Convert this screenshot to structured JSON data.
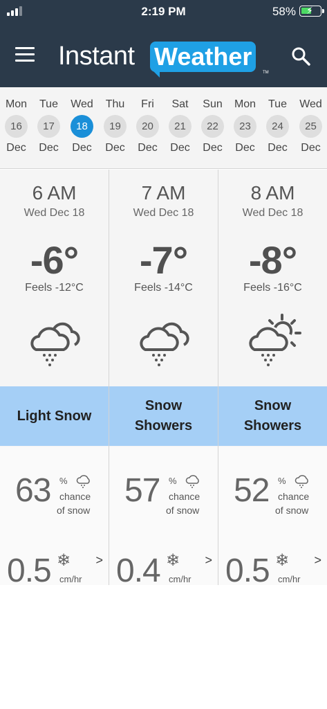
{
  "status": {
    "time": "2:19 PM",
    "battery": "58%"
  },
  "brand": {
    "part1": "Instant",
    "part2": "Weather",
    "tm": "TM"
  },
  "colors": {
    "header": "#2b3a4a",
    "accent": "#1a8fd8",
    "condition_band": "#a5cff6"
  },
  "days": [
    {
      "name": "Mon",
      "num": "16",
      "month": "Dec",
      "selected": false
    },
    {
      "name": "Tue",
      "num": "17",
      "month": "Dec",
      "selected": false
    },
    {
      "name": "Wed",
      "num": "18",
      "month": "Dec",
      "selected": true
    },
    {
      "name": "Thu",
      "num": "19",
      "month": "Dec",
      "selected": false
    },
    {
      "name": "Fri",
      "num": "20",
      "month": "Dec",
      "selected": false
    },
    {
      "name": "Sat",
      "num": "21",
      "month": "Dec",
      "selected": false
    },
    {
      "name": "Sun",
      "num": "22",
      "month": "Dec",
      "selected": false
    },
    {
      "name": "Mon",
      "num": "23",
      "month": "Dec",
      "selected": false
    },
    {
      "name": "Tue",
      "num": "24",
      "month": "Dec",
      "selected": false
    },
    {
      "name": "Wed",
      "num": "25",
      "month": "Dec",
      "selected": false
    }
  ],
  "hours": [
    {
      "hour": "6 AM",
      "date": "Wed Dec 18",
      "temp": "-6°",
      "feels": "Feels -12°C",
      "icon": "cloud-snow-icon",
      "condition": "Light Snow",
      "chance": "63",
      "chance_pct": "%",
      "chance_l1": "chance",
      "chance_l2": "of snow",
      "accum": "0.5",
      "unit": "cm/hr",
      "arrow": ">"
    },
    {
      "hour": "7 AM",
      "date": "Wed Dec 18",
      "temp": "-7°",
      "feels": "Feels -14°C",
      "icon": "cloud-snow-icon",
      "condition": "Snow Showers",
      "chance": "57",
      "chance_pct": "%",
      "chance_l1": "chance",
      "chance_l2": "of snow",
      "accum": "0.4",
      "unit": "cm/hr",
      "arrow": ">"
    },
    {
      "hour": "8 AM",
      "date": "Wed Dec 18",
      "temp": "-8°",
      "feels": "Feels -16°C",
      "icon": "sun-cloud-snow-icon",
      "condition": "Snow Showers",
      "chance": "52",
      "chance_pct": "%",
      "chance_l1": "chance",
      "chance_l2": "of snow",
      "accum": "0.5",
      "unit": "cm/hr",
      "arrow": ">"
    }
  ]
}
